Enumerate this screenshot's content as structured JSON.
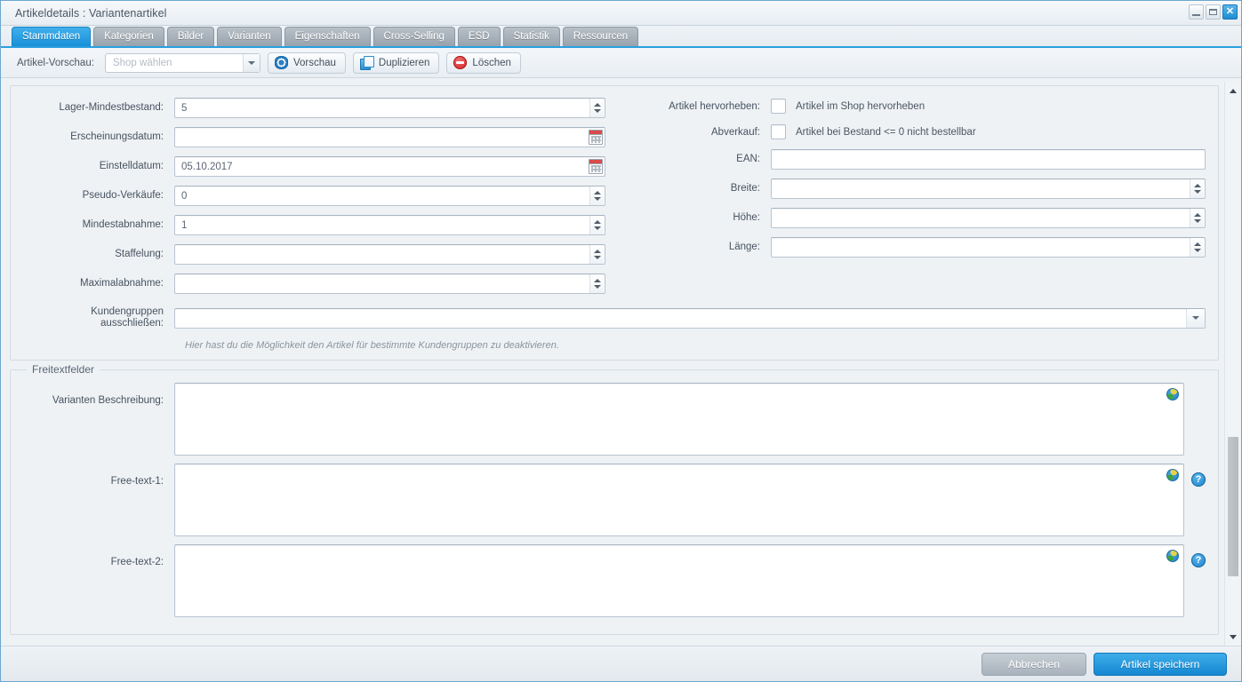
{
  "window": {
    "title": "Artikeldetails : Variantenartikel",
    "controls": {
      "minimize": "–",
      "maximize": "□",
      "close": "✕"
    }
  },
  "tabs": [
    {
      "label": "Stammdaten",
      "active": true
    },
    {
      "label": "Kategorien",
      "active": false
    },
    {
      "label": "Bilder",
      "active": false
    },
    {
      "label": "Varianten",
      "active": false
    },
    {
      "label": "Eigenschaften",
      "active": false
    },
    {
      "label": "Cross-Selling",
      "active": false
    },
    {
      "label": "ESD",
      "active": false
    },
    {
      "label": "Statistik",
      "active": false
    },
    {
      "label": "Ressourcen",
      "active": false
    }
  ],
  "toolbar": {
    "preview_label": "Artikel-Vorschau:",
    "shop_select_placeholder": "Shop wählen",
    "shop_select_value": "",
    "preview_button": "Vorschau",
    "duplicate_button": "Duplizieren",
    "delete_button": "Löschen"
  },
  "form": {
    "left": [
      {
        "label": "Lager-Mindestbestand:",
        "value": "5",
        "control": "spinner"
      },
      {
        "label": "Erscheinungsdatum:",
        "value": "",
        "control": "date"
      },
      {
        "label": "Einstelldatum:",
        "value": "05.10.2017",
        "control": "date"
      },
      {
        "label": "Pseudo-Verkäufe:",
        "value": "0",
        "control": "spinner"
      },
      {
        "label": "Mindestabnahme:",
        "value": "1",
        "control": "spinner"
      },
      {
        "label": "Staffelung:",
        "value": "",
        "control": "spinner"
      },
      {
        "label": "Maximalabnahme:",
        "value": "",
        "control": "spinner"
      }
    ],
    "right": [
      {
        "label": "Artikel hervorheben:",
        "checkbox_label": "Artikel im Shop hervorheben",
        "checked": false,
        "control": "checkbox"
      },
      {
        "label": "Abverkauf:",
        "checkbox_label": "Artikel bei Bestand <= 0 nicht bestellbar",
        "checked": false,
        "control": "checkbox"
      },
      {
        "label": "EAN:",
        "value": "",
        "control": "text"
      },
      {
        "label": "Breite:",
        "value": "",
        "control": "spinner"
      },
      {
        "label": "Höhe:",
        "value": "",
        "control": "spinner"
      },
      {
        "label": "Länge:",
        "value": "",
        "control": "spinner"
      }
    ],
    "customer_groups": {
      "label": "Kundengruppen ausschließen:",
      "label_line1": "Kundengruppen",
      "label_line2": "ausschließen:",
      "value": "",
      "hint": "Hier hast du die Möglichkeit den Artikel für bestimmte Kundengruppen zu deaktivieren."
    }
  },
  "freetext": {
    "legend": "Freitextfelder",
    "fields": [
      {
        "label": "Varianten Beschreibung:",
        "value": "",
        "has_help": false,
        "has_globe": true
      },
      {
        "label": "Free-text-1:",
        "value": "",
        "has_help": true,
        "has_globe": true
      },
      {
        "label": "Free-text-2:",
        "value": "",
        "has_help": true,
        "has_globe": true
      }
    ],
    "help_glyph": "?"
  },
  "footer": {
    "cancel_label": "Abbrechen",
    "save_label": "Artikel speichern"
  },
  "colors": {
    "accent": "#1a8ed4",
    "tab_active": "#2a9fe0",
    "panel_bg": "#eef2f5",
    "delete_red": "#cf2020"
  }
}
